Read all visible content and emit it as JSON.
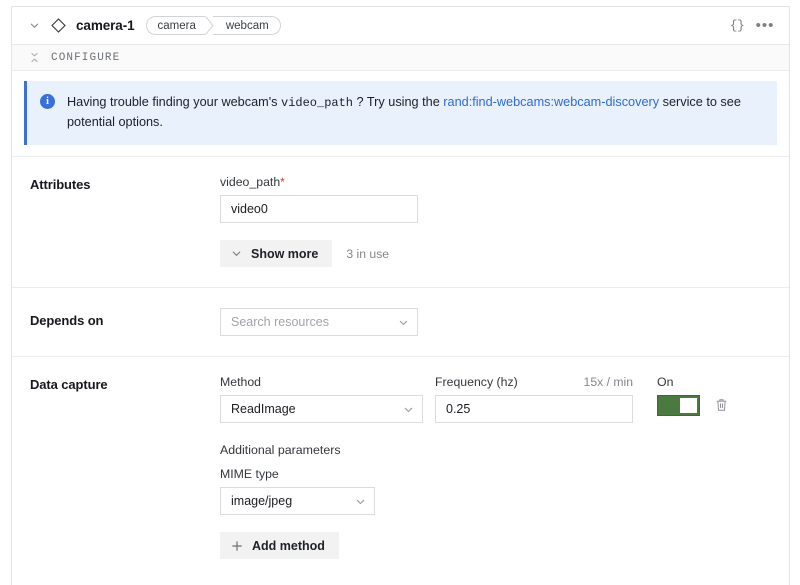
{
  "header": {
    "collapse_icon": "chevron-down-icon",
    "type_icon": "diamond-icon",
    "resource_name": "camera-1",
    "chips": [
      "camera",
      "webcam"
    ],
    "json_icon_label": "{}",
    "more_icon_label": "•••"
  },
  "configure": {
    "collapse_icon": "collapse-vertical-icon",
    "label": "CONFIGURE"
  },
  "banner": {
    "icon": "info-icon",
    "icon_glyph": "i",
    "text_before": "Having trouble finding your webcam's",
    "code": "video_path",
    "text_middle": "? Try using the",
    "link": "rand:find-webcams:webcam-discovery",
    "text_after": "service to see potential options.",
    "accent_color": "#3f6fd8",
    "background_color": "#e9f1fd"
  },
  "attributes": {
    "section_label": "Attributes",
    "field_label": "video_path",
    "required_mark": "*",
    "value": "video0",
    "show_more_label": "Show more",
    "show_more_icon": "chevron-down-icon",
    "in_use_note": "3 in use"
  },
  "depends_on": {
    "section_label": "Depends on",
    "placeholder": "Search resources",
    "caret_icon": "chevron-down-icon"
  },
  "data_capture": {
    "section_label": "Data capture",
    "method_label": "Method",
    "method_value": "ReadImage",
    "frequency_label": "Frequency (hz)",
    "frequency_hint": "15x / min",
    "frequency_value": "0.25",
    "toggle_label": "On",
    "toggle_state": "on",
    "toggle_color": "#4b7a40",
    "delete_icon": "trash-icon",
    "additional_params_label": "Additional parameters",
    "mime_label": "MIME type",
    "mime_value": "image/jpeg",
    "add_method_label": "Add method",
    "add_method_icon": "plus-icon"
  }
}
